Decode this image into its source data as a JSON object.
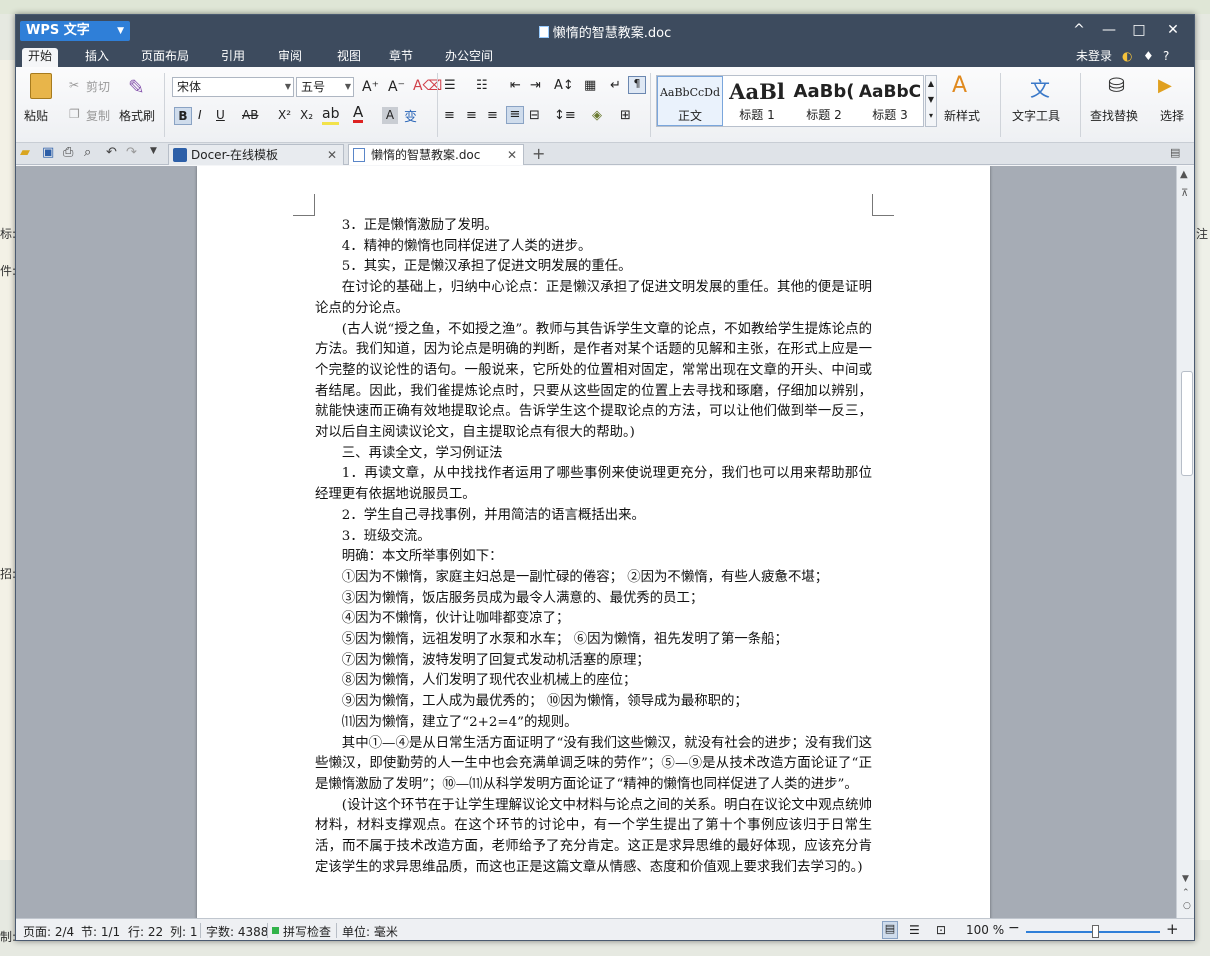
{
  "app": {
    "name": "WPS 文字",
    "doc_title": "懒惰的智慧教案.doc"
  },
  "window_controls": {
    "caret": "^",
    "minimize": "—",
    "maximize": "□",
    "close": "✕"
  },
  "menu": {
    "items": [
      "开始",
      "插入",
      "页面布局",
      "引用",
      "审阅",
      "视图",
      "章节",
      "办公空间"
    ],
    "right": [
      "未登录",
      "?"
    ]
  },
  "ribbon": {
    "paste": "粘贴",
    "cut": "剪切",
    "copy": "复制",
    "format_painter": "格式刷",
    "font": "宋体",
    "size": "五号",
    "bold": "B",
    "italic": "I",
    "underline": "U",
    "strike": "AB",
    "superscript": "X²",
    "subscript": "X₂",
    "styles": [
      {
        "sample": "AaBbCcDd",
        "label": "正文"
      },
      {
        "sample": "AaBl",
        "label": "标题 1"
      },
      {
        "sample": "AaBb(",
        "label": "标题 2"
      },
      {
        "sample": "AaBbC",
        "label": "标题 3"
      }
    ],
    "new_style": "新样式",
    "text_tools": "文字工具",
    "find_replace": "查找替换",
    "select": "选择"
  },
  "tabs": [
    {
      "label": "Docer-在线模板"
    },
    {
      "label": "懒惰的智慧教案.doc"
    }
  ],
  "document": {
    "paragraphs": [
      {
        "text": "3．正是懒惰激励了发明。",
        "indent": true
      },
      {
        "text": "4．精神的懒惰也同样促进了人类的进步。",
        "indent": true
      },
      {
        "text": "5．其实，正是懒汉承担了促进文明发展的重任。",
        "indent": true
      },
      {
        "text": "在讨论的基础上，归纳中心论点：正是懒汉承担了促进文明发展的重任。其他的便是证明论点的分论点。",
        "indent": true
      },
      {
        "text": "(古人说“授之鱼，不如授之渔”。教师与其告诉学生文章的论点，不如教给学生提炼论点的方法。我们知道，因为论点是明确的判断，是作者对某个话题的见解和主张，在形式上应是一个完整的议论性的语句。一般说来，它所处的位置相对固定，常常出现在文章的开头、中间或者结尾。因此，我们雀提炼论点时，只要从这些固定的位置上去寻找和琢磨，仔细加以辨别，就能快速而正确有效地提取论点。告诉学生这个提取论点的方法，可以让他们做到举一反三，对以后自主阅读议论文，自主提取论点有很大的帮助。)",
        "indent": true
      },
      {
        "text": "三、再读全文，学习例证法",
        "indent": true
      },
      {
        "text": "1．再读文章，从中找找作者运用了哪些事例来使说理更充分，我们也可以用来帮助那位经理更有依据地说服员工。",
        "indent": true
      },
      {
        "text": "2．学生自己寻找事例，并用简洁的语言概括出来。",
        "indent": true
      },
      {
        "text": "3．班级交流。",
        "indent": true
      },
      {
        "text": "明确：本文所举事例如下：",
        "indent": true
      },
      {
        "text": "①因为不懒惰，家庭主妇总是一副忙碌的倦容；  ②因为不懒惰，有些人疲惫不堪；",
        "indent": true
      },
      {
        "text": "③因为懒惰，饭店服务员成为最令人满意的、最优秀的员工；",
        "indent": true
      },
      {
        "text": "④因为不懒惰，伙计让咖啡都变凉了；",
        "indent": true
      },
      {
        "text": "⑤因为懒惰，远祖发明了水泵和水车；  ⑥因为懒惰，祖先发明了第一条船；",
        "indent": true
      },
      {
        "text": "⑦因为懒惰，波特发明了回复式发动机活塞的原理；",
        "indent": true
      },
      {
        "text": "⑧因为懒惰，人们发明了现代农业机械上的座位；",
        "indent": true
      },
      {
        "text": "⑨因为懒惰，工人成为最优秀的；  ⑩因为懒惰，领导成为最称职的；",
        "indent": true
      },
      {
        "text": "⑾因为懒惰，建立了“2+2=4”的规则。",
        "indent": true
      },
      {
        "text": "其中①—④是从日常生活方面证明了“没有我们这些懒汉，就没有社会的进步；没有我们这些懒汉，即使勤劳的人一生中也会充满单调乏味的劳作”；⑤—⑨是从技术改造方面论证了“正是懒惰激励了发明”；⑩—⑾从科学发明方面论证了“精神的懒惰也同样促进了人类的进步”。",
        "indent": true
      },
      {
        "text": "(设计这个环节在于让学生理解议论文中材料与论点之间的关系。明白在议论文中观点统帅材料，材料支撑观点。在这个环节的讨论中，有一个学生提出了第十个事例应该归于日常生活，而不属于技术改造方面，老师给予了充分肯定。这正是求异思维的最好体现，应该充分肯定该学生的求异思维品质，而这也正是这篇文章从情感、态度和价值观上要求我们去学习的。)",
        "indent": true
      }
    ]
  },
  "status": {
    "page": "页面: 2/4",
    "section": "节: 1/1",
    "line": "行: 22",
    "column": "列: 1",
    "words": "字数: 4388",
    "spell": "拼写检查",
    "unit": "单位: 毫米",
    "zoom": "100 %",
    "zoom_level": 0.52
  },
  "background": {
    "left_labels": [
      "标:",
      "件:",
      "招:",
      "制:"
    ],
    "right_labels": [
      "注"
    ]
  }
}
